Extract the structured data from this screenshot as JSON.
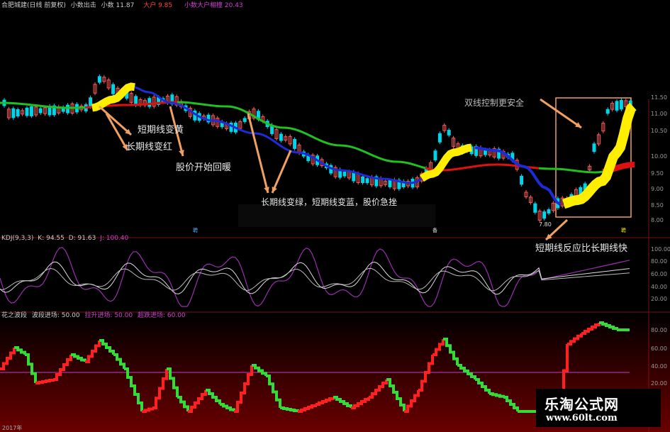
{
  "header": {
    "stock_name": "合肥城建(日线 前复权)",
    "indicator_name": "小数出击",
    "small_label": "小数",
    "small_value": "11.87",
    "big_label": "大户",
    "big_value": "9.85",
    "detail_label": "小数大户相撞",
    "detail_value": "20.43"
  },
  "kdj": {
    "label": "KDJ(9,3,3)",
    "k": "K: 94.55",
    "d": "D: 91.63",
    "j": "J: 100.40"
  },
  "wave": {
    "label": "花之波段",
    "w1": "波段进场: 50.00",
    "w2": "拉升进场: 50.00",
    "w3": "超跌进场: 60.00"
  },
  "annotations": {
    "a1": "短期线变黄",
    "a2": "长期线变红",
    "a3": "股价开始回暖",
    "a4": "长期线变绿，短期线变蓝，股价急挫",
    "a5": "双线控制更安全",
    "a6": "短期线反应比长期线快",
    "low": "7.80"
  },
  "axis_main": [
    "11.50",
    "11.00",
    "10.50",
    "10.00",
    "9.50",
    "9.00",
    "8.50",
    "8.00"
  ],
  "axis_kdj": [
    "100.00",
    "80.00",
    "60.00",
    "40.00",
    "20.00"
  ],
  "axis_wave": [
    "80.00",
    "60.00",
    "40.00",
    "20.00"
  ],
  "bottom_date": "2017年",
  "markers": {
    "m1": "聘",
    "m2": "备",
    "m3": "聘"
  },
  "watermark": {
    "title": "乐淘公式网",
    "url": "www.60lt.com"
  },
  "colors": {
    "bull": "#00d4e8",
    "bear": "#ff5a5a",
    "short_line_up": "#ffee00",
    "short_line_down": "#1e2bd8",
    "long_line_down": "#21c021",
    "long_line_up": "#e01010",
    "wave_up": "#ff2020",
    "wave_down": "#33dd33",
    "arrow": "#f0a060"
  }
}
